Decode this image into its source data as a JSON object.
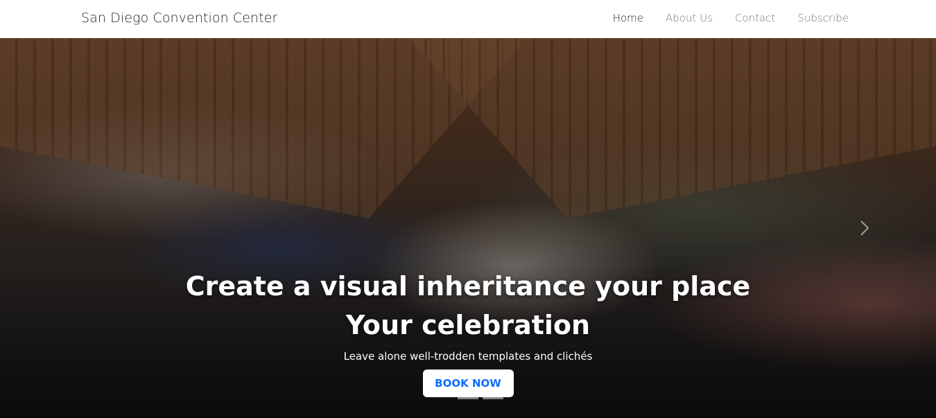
{
  "navbar": {
    "brand": "San Diego Convention Center",
    "links": [
      {
        "label": "Home",
        "active": true
      },
      {
        "label": "About Us",
        "active": false
      },
      {
        "label": "Contact",
        "active": false
      },
      {
        "label": "Subscribe",
        "active": false
      }
    ]
  },
  "hero": {
    "headline_line1": "Create a visual inheritance your place",
    "headline_line2": "Your celebration",
    "subtitle": "Leave alone well-trodden templates and clichés",
    "cta_label": "BOOK NOW",
    "indicators": 3,
    "active_indicator": 1,
    "next_icon": "chevron-right-icon"
  },
  "colors": {
    "cta_text": "#0d6efd",
    "nav_active": "#222222",
    "nav_inactive": "#7a7a7a"
  }
}
